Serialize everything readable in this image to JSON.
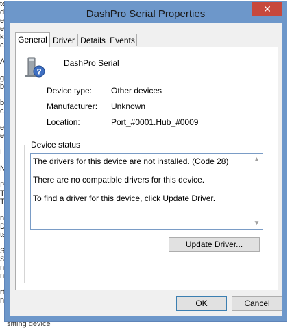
{
  "window": {
    "title": "DashPro Serial Properties",
    "close_glyph": "✕"
  },
  "tabs": [
    {
      "label": "General",
      "active": true
    },
    {
      "label": "Driver",
      "active": false
    },
    {
      "label": "Details",
      "active": false
    },
    {
      "label": "Events",
      "active": false
    }
  ],
  "device": {
    "icon": "unknown-device-icon",
    "name": "DashPro Serial"
  },
  "properties": [
    {
      "label": "Device type:",
      "value": "Other devices"
    },
    {
      "label": "Manufacturer:",
      "value": "Unknown"
    },
    {
      "label": "Location:",
      "value": "Port_#0001.Hub_#0009"
    }
  ],
  "device_status": {
    "title": "Device status",
    "lines": [
      "The drivers for this device are not installed. (Code 28)",
      "There are no compatible drivers for this device.",
      "To find a driver for this device, click Update Driver."
    ]
  },
  "buttons": {
    "update_driver": "Update Driver...",
    "ok": "OK",
    "cancel": "Cancel"
  },
  "background_fragments": {
    "left_strip": [
      "te",
      "d",
      "e",
      "e",
      "k",
      "c",
      "",
      "A",
      "",
      "g",
      "b",
      "",
      "b",
      "ce",
      "",
      "e",
      "e",
      "",
      "L",
      "",
      "N",
      "",
      "P",
      "T",
      "T",
      "",
      "ne",
      "D",
      "ts",
      "",
      "S",
      "S",
      "nt",
      "nt",
      "",
      "rt",
      "nt"
    ],
    "bottom": "sitting device"
  },
  "colors": {
    "frame": "#6d97ca",
    "close_button": "#c7483c",
    "client": "#f0f0f0",
    "status_border": "#7a9cc6"
  }
}
